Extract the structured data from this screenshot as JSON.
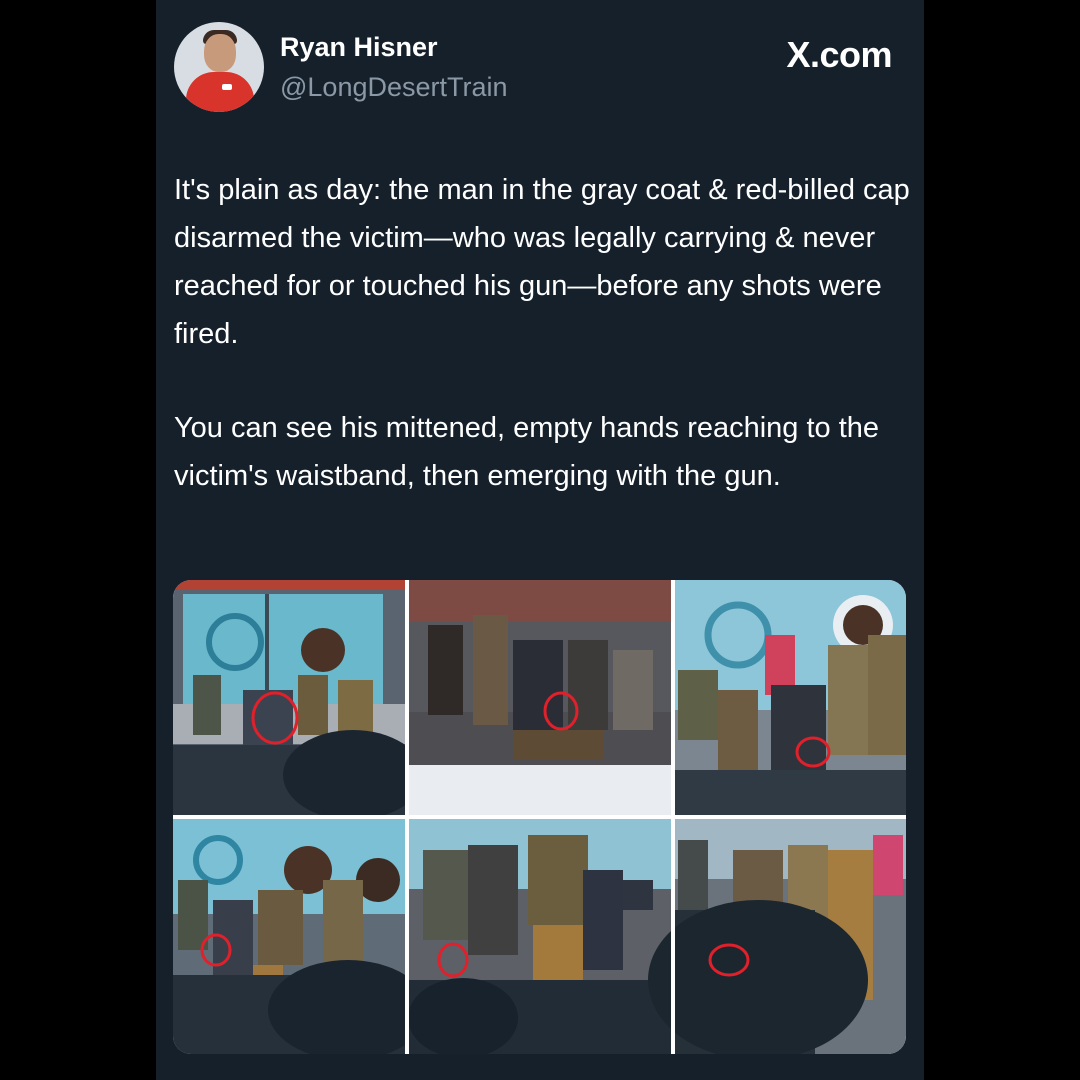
{
  "author": {
    "name": "Ryan Hisner",
    "handle": "@LongDesertTrain",
    "avatar_icon": "profile-photo"
  },
  "brand": "X.com",
  "tweet": {
    "paragraph_1": "It's plain as day: the man in the gray coat & red-billed cap disarmed the victim—who was legally carrying & never reached for or touched his gun—before any shots were fired.",
    "paragraph_2": "You can see his mittened, empty hands reaching to the victim's waistband, then emerging with the gun."
  },
  "media": {
    "layout": "2x3 photo collage",
    "highlight_color": "#e0202a",
    "panel_count": 6
  }
}
